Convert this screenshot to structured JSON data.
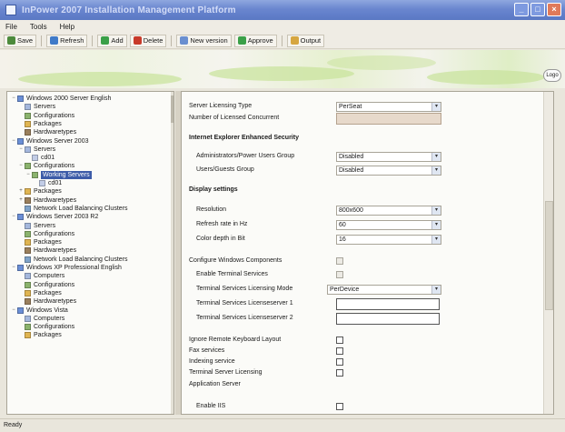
{
  "window": {
    "title": "InPower 2007 Installation Management Platform"
  },
  "menu": [
    "File",
    "Tools",
    "Help"
  ],
  "toolbar": [
    {
      "label": "Save",
      "color": "#4c8a3c"
    },
    {
      "label": "Refresh",
      "color": "#3f7ac8"
    },
    {
      "label": "Add",
      "color": "#3aa048"
    },
    {
      "label": "Delete",
      "color": "#c83a2a"
    },
    {
      "label": "New version",
      "color": "#6a8fd0"
    },
    {
      "label": "Approve",
      "color": "#3aa048"
    },
    {
      "label": "Output",
      "color": "#d6a640"
    }
  ],
  "banner_button": "Logo",
  "tree": [
    {
      "label": "Windows 2000 Server English",
      "level": 0,
      "icon": "os-icon",
      "color": "#6b8fd6",
      "exp": "−"
    },
    {
      "label": "Servers",
      "level": 1,
      "icon": "servers-icon",
      "color": "#a5b8dd",
      "exp": ""
    },
    {
      "label": "Configurations",
      "level": 1,
      "icon": "config-icon",
      "color": "#8bb36d",
      "exp": ""
    },
    {
      "label": "Packages",
      "level": 1,
      "icon": "package-icon",
      "color": "#e0b552",
      "exp": ""
    },
    {
      "label": "Hardwaretypes",
      "level": 1,
      "icon": "hardware-icon",
      "color": "#9a7f5c",
      "exp": ""
    },
    {
      "label": "Windows Server 2003",
      "level": 0,
      "icon": "os-icon",
      "color": "#6b8fd6",
      "exp": "−"
    },
    {
      "label": "Servers",
      "level": 1,
      "icon": "servers-icon",
      "color": "#a5b8dd",
      "exp": "−"
    },
    {
      "label": "cd01",
      "level": 2,
      "icon": "server-icon",
      "color": "#c2cde6",
      "exp": ""
    },
    {
      "label": "Configurations",
      "level": 1,
      "icon": "config-icon",
      "color": "#8bb36d",
      "exp": "−"
    },
    {
      "label": "Working Servers",
      "level": 2,
      "icon": "config-icon",
      "color": "#8bb36d",
      "exp": "−",
      "selected": true
    },
    {
      "label": "cd01",
      "level": 3,
      "icon": "server-icon",
      "color": "#c2cde6",
      "exp": ""
    },
    {
      "label": "Packages",
      "level": 1,
      "icon": "package-icon",
      "color": "#e0b552",
      "exp": "+"
    },
    {
      "label": "Hardwaretypes",
      "level": 1,
      "icon": "hardware-icon",
      "color": "#9a7f5c",
      "exp": "+"
    },
    {
      "label": "Network Load Balancing Clusters",
      "level": 1,
      "icon": "cluster-icon",
      "color": "#7fa3c9",
      "exp": ""
    },
    {
      "label": "Windows Server 2003 R2",
      "level": 0,
      "icon": "os-icon",
      "color": "#6b8fd6",
      "exp": "−"
    },
    {
      "label": "Servers",
      "level": 1,
      "icon": "servers-icon",
      "color": "#a5b8dd",
      "exp": ""
    },
    {
      "label": "Configurations",
      "level": 1,
      "icon": "config-icon",
      "color": "#8bb36d",
      "exp": ""
    },
    {
      "label": "Packages",
      "level": 1,
      "icon": "package-icon",
      "color": "#e0b552",
      "exp": ""
    },
    {
      "label": "Hardwaretypes",
      "level": 1,
      "icon": "hardware-icon",
      "color": "#9a7f5c",
      "exp": ""
    },
    {
      "label": "Network Load Balancing Clusters",
      "level": 1,
      "icon": "cluster-icon",
      "color": "#7fa3c9",
      "exp": ""
    },
    {
      "label": "Windows XP Professional English",
      "level": 0,
      "icon": "os-icon",
      "color": "#6b8fd6",
      "exp": "−"
    },
    {
      "label": "Computers",
      "level": 1,
      "icon": "computer-icon",
      "color": "#a5b8dd",
      "exp": ""
    },
    {
      "label": "Configurations",
      "level": 1,
      "icon": "config-icon",
      "color": "#8bb36d",
      "exp": ""
    },
    {
      "label": "Packages",
      "level": 1,
      "icon": "package-icon",
      "color": "#e0b552",
      "exp": ""
    },
    {
      "label": "Hardwaretypes",
      "level": 1,
      "icon": "hardware-icon",
      "color": "#9a7f5c",
      "exp": ""
    },
    {
      "label": "Windows Vista",
      "level": 0,
      "icon": "os-icon",
      "color": "#6b8fd6",
      "exp": "−"
    },
    {
      "label": "Computers",
      "level": 1,
      "icon": "computer-icon",
      "color": "#a5b8dd",
      "exp": ""
    },
    {
      "label": "Configurations",
      "level": 1,
      "icon": "config-icon",
      "color": "#8bb36d",
      "exp": ""
    },
    {
      "label": "Packages",
      "level": 1,
      "icon": "package-icon",
      "color": "#e0b552",
      "exp": ""
    }
  ],
  "properties": [
    {
      "label": "Server Licensing Type",
      "indent": 0,
      "control": "combo",
      "value": "PerSeat"
    },
    {
      "label": "Number of Licensed Concurrent",
      "indent": 0,
      "control": "text-disabled",
      "value": ""
    },
    {
      "label": "Internet Explorer Enhanced Security",
      "indent": 0,
      "control": "section"
    },
    {
      "label": "Administrators/Power Users Group",
      "indent": 1,
      "control": "combo",
      "value": "Disabled"
    },
    {
      "label": "Users/Guests Group",
      "indent": 1,
      "control": "combo",
      "value": "Disabled"
    },
    {
      "label": "Display settings",
      "indent": 0,
      "control": "section"
    },
    {
      "label": "Resolution",
      "indent": 1,
      "control": "combo",
      "value": "800x600"
    },
    {
      "label": "Refresh rate in Hz",
      "indent": 1,
      "control": "combo",
      "value": "60"
    },
    {
      "label": "Color depth in Bit",
      "indent": 1,
      "control": "combo",
      "value": "16"
    },
    {
      "label": "Configure Windows Components",
      "indent": 0,
      "control": "check-disabled"
    },
    {
      "label": "Enable Terminal Services",
      "indent": 1,
      "control": "check-disabled"
    },
    {
      "label": "Terminal Services Licensing Mode",
      "indent": 1,
      "control": "combo-wide",
      "value": "PerDevice"
    },
    {
      "label": "Terminal Services Licenseserver 1",
      "indent": 1,
      "control": "text"
    },
    {
      "label": "Terminal Services Licenseserver 2",
      "indent": 1,
      "control": "text"
    },
    {
      "label": "Ignore Remote Keyboard Layout",
      "indent": 0,
      "control": "check"
    },
    {
      "label": "Fax services",
      "indent": 0,
      "control": "check"
    },
    {
      "label": "Indexing service",
      "indent": 0,
      "control": "check"
    },
    {
      "label": "Terminal Server Licensing",
      "indent": 0,
      "control": "check"
    },
    {
      "label": "Application Server",
      "indent": 0,
      "control": "none"
    },
    {
      "label": "Enable IIS",
      "indent": 1,
      "control": "check"
    }
  ],
  "status": {
    "text": "Ready"
  }
}
